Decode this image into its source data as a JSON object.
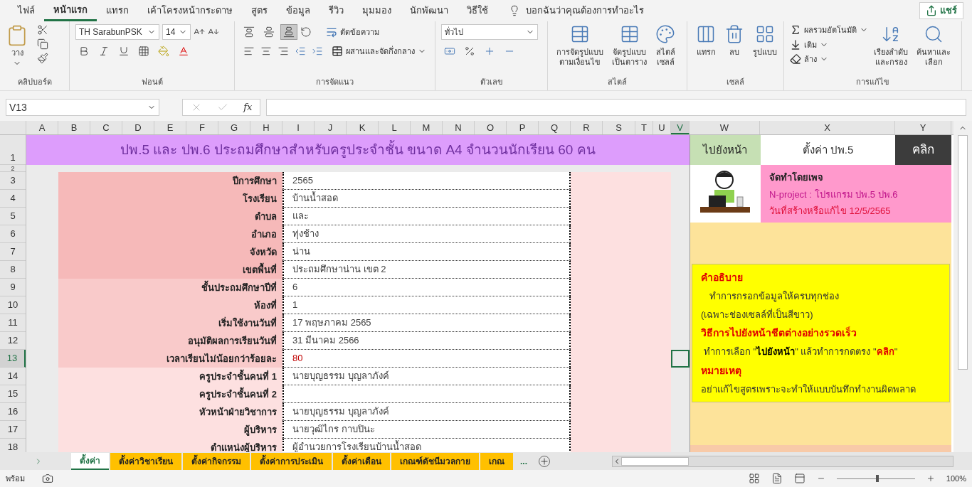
{
  "menu_tabs": [
    {
      "label": "ไฟล์",
      "selected": false
    },
    {
      "label": "หน้าแรก",
      "selected": true
    },
    {
      "label": "แทรก",
      "selected": false
    },
    {
      "label": "เค้าโครงหน้ากระดาษ",
      "selected": false
    },
    {
      "label": "สูตร",
      "selected": false
    },
    {
      "label": "ข้อมูล",
      "selected": false
    },
    {
      "label": "รีวิว",
      "selected": false
    },
    {
      "label": "มุมมอง",
      "selected": false
    },
    {
      "label": "นักพัฒนา",
      "selected": false
    },
    {
      "label": "วิธีใช้",
      "selected": false
    }
  ],
  "tell_me": "บอกฉันว่าคุณต้องการทำอะไร",
  "share": "แชร์",
  "ribbon": {
    "clipboard": {
      "title": "คลิปบอร์ด",
      "paste": "วาง"
    },
    "font": {
      "title": "ฟอนต์",
      "family": "TH SarabunPSK",
      "size": "14"
    },
    "alignment": {
      "title": "การจัดแนว",
      "vertical": [
        {
          "selected": false
        },
        {
          "selected": false
        },
        {
          "selected": true
        }
      ],
      "wrap": "ตัดข้อความ",
      "merge": "ผสานและจัดกึ่งกลาง"
    },
    "number": {
      "title": "ตัวเลข",
      "format": "ทั่วไป"
    },
    "styles": {
      "title": "สไตล์",
      "buttons": [
        {
          "lines": [
            "การจัดรูปแบบ",
            "ตามเงื่อนไข"
          ]
        },
        {
          "lines": [
            "จัดรูปแบบ",
            "เป็นตาราง"
          ]
        },
        {
          "lines": [
            "สไตล์",
            "เซลล์"
          ]
        }
      ]
    },
    "cells": {
      "title": "เซลล์",
      "buttons": [
        "แทรก",
        "ลบ",
        "รูปแบบ"
      ]
    },
    "editing": {
      "title": "การแก้ไข",
      "small": [
        "ผลรวมอัตโนมัติ",
        "เติม",
        "ล้าง"
      ],
      "big": [
        {
          "lines": [
            "เรียงลำดับ",
            "และกรอง"
          ]
        },
        {
          "lines": [
            "ค้นหาและ",
            "เลือก"
          ]
        }
      ]
    }
  },
  "name_box": "V13",
  "function_label": "fx",
  "columns": [
    {
      "label": "A",
      "selected": false
    },
    {
      "label": "B",
      "selected": false
    },
    {
      "label": "C",
      "selected": false
    },
    {
      "label": "D",
      "selected": false
    },
    {
      "label": "E",
      "selected": false
    },
    {
      "label": "F",
      "selected": false
    },
    {
      "label": "G",
      "selected": false
    },
    {
      "label": "H",
      "selected": false
    },
    {
      "label": "I",
      "selected": false
    },
    {
      "label": "J",
      "selected": false
    },
    {
      "label": "K",
      "selected": false
    },
    {
      "label": "L",
      "selected": false
    },
    {
      "label": "M",
      "selected": false
    },
    {
      "label": "N",
      "selected": false
    },
    {
      "label": "O",
      "selected": false
    },
    {
      "label": "P",
      "selected": false
    },
    {
      "label": "Q",
      "selected": false
    },
    {
      "label": "R",
      "selected": false
    },
    {
      "label": "S",
      "selected": false
    },
    {
      "label": "T",
      "selected": false
    },
    {
      "label": "U",
      "selected": false
    },
    {
      "label": "V",
      "selected": true
    },
    {
      "label": "W",
      "selected": false
    },
    {
      "label": "X",
      "selected": false
    },
    {
      "label": "Y",
      "selected": false
    }
  ],
  "title_row": {
    "number": "1",
    "title": "ปพ.5 และ ปพ.6 ประถมศึกษาสำหรับครูประจำชั้น ขนาด A4 จำนวนนักเรียน 60 คน",
    "goto": "ไปยังหน้า",
    "target": "ตั้งค่า ปพ.5",
    "click": "คลิก"
  },
  "row_2": "2",
  "rows": [
    {
      "number": "3",
      "label": "ปีการศึกษา",
      "value": "2565",
      "kind": "dark",
      "color": "#404040",
      "selected": false
    },
    {
      "number": "4",
      "label": "โรงเรียน",
      "value": "บ้านน้ำสอด",
      "kind": "dark",
      "color": "#404040",
      "selected": false
    },
    {
      "number": "5",
      "label": "ตำบล",
      "value": "และ",
      "kind": "dark",
      "color": "#404040",
      "selected": false
    },
    {
      "number": "6",
      "label": "อำเภอ",
      "value": "ทุ่งช้าง",
      "kind": "dark",
      "color": "#404040",
      "selected": false
    },
    {
      "number": "7",
      "label": "จังหวัด",
      "value": "น่าน",
      "kind": "dark",
      "color": "#404040",
      "selected": false
    },
    {
      "number": "8",
      "label": "เขตพื้นที่",
      "value": "ประถมศึกษาน่าน เขต 2",
      "kind": "dark",
      "color": "#404040",
      "selected": false
    },
    {
      "number": "9",
      "label": "ชั้นประถมศึกษาปีที่",
      "value": "6",
      "kind": "medium",
      "color": "#404040",
      "selected": false
    },
    {
      "number": "10",
      "label": "ห้องที่",
      "value": "1",
      "kind": "medium",
      "color": "#404040",
      "selected": false
    },
    {
      "number": "11",
      "label": "เริ่มใช้งานวันที่",
      "value": "17 พฤษภาคม 2565",
      "kind": "medium",
      "color": "#404040",
      "selected": false
    },
    {
      "number": "12",
      "label": "อนุมัติผลการเรียนวันที่",
      "value": "31 มีนาคม 2566",
      "kind": "medium",
      "color": "#404040",
      "selected": false
    },
    {
      "number": "13",
      "label": "เวลาเรียนไม่น้อยกว่าร้อยละ",
      "value": "80",
      "kind": "medium",
      "color": "#c00000",
      "selected": true
    },
    {
      "number": "14",
      "label": "ครูประจำชั้นคนที่ 1",
      "value": "นายบุญธรรม  บุญลาภังค์",
      "kind": "light",
      "color": "#404040",
      "selected": false
    },
    {
      "number": "15",
      "label": "ครูประจำชั้นคนที่ 2",
      "kind": "light",
      "color": "#404040",
      "selected": false
    },
    {
      "number": "16",
      "label": "หัวหน้าฝ่ายวิชาการ",
      "value": "นายบุญธรรม  บุญลาภังค์",
      "kind": "light",
      "color": "#404040",
      "selected": false
    },
    {
      "number": "17",
      "label": "ผู้บริหาร",
      "value": "นายวุฒิไกร  กาบปินะ",
      "kind": "light",
      "color": "#404040",
      "selected": false
    },
    {
      "number": "18",
      "label": "ตำแหน่งผู้บริหาร",
      "value": "ผู้อำนวยการโรงเรียนบ้านน้ำสอด",
      "kind": "light",
      "color": "#404040",
      "selected": false
    }
  ],
  "credit": {
    "author": "จัดทำโดยเพจ",
    "program": "N-project : โปรแกรม ปพ.5 ปพ.6",
    "date": "วันที่สร้างหรือแก้ไข 12/5/2565"
  },
  "notes": [
    {
      "kind": "heading",
      "text": "คำอธิบาย"
    },
    {
      "kind": "indent",
      "text": "ทำการกรอกข้อมูลให้ครบทุกช่อง"
    },
    {
      "kind": "text",
      "text": "(เฉพาะช่องเซลล์ที่เป็นสีขาว)"
    },
    {
      "kind": "heading",
      "text": "วิธีการไปยังหน้าชีตต่างอย่างรวดเร็ว"
    },
    {
      "kind": "mixed",
      "parts": [
        {
          "kind": "plain",
          "text": "ทำการเลือก \""
        },
        {
          "kind": "bold",
          "text": "ไปยังหน้า"
        },
        {
          "kind": "plain",
          "text": "\" แล้วทำการกดตรง \""
        },
        {
          "kind": "alert",
          "text": "คลิก"
        },
        {
          "kind": "plain",
          "text": "\""
        }
      ]
    },
    {
      "kind": "heading",
      "text": "หมายเหตุ"
    },
    {
      "kind": "text",
      "text": "อย่าแก้ไขสูตรเพราะจะทำให้แบบบันทึกทำงานผิดพลาด"
    }
  ],
  "sheet_tabs": [
    {
      "label": "ตั้งค่า",
      "selected": true
    },
    {
      "label": "ตั้งค่าวิชาเรียน",
      "selected": false
    },
    {
      "label": "ตั้งค่ากิจกรรม",
      "selected": false
    },
    {
      "label": "ตั้งค่าการประเมิน",
      "selected": false
    },
    {
      "label": "ตั้งค่าเดือน",
      "selected": false
    },
    {
      "label": "เกณฑ์ดัชนีมวลกาย",
      "selected": false
    },
    {
      "label": "เกณ",
      "selected": false
    }
  ],
  "more_tabs": "...",
  "status": {
    "ready": "พร้อม",
    "zoom": "100%",
    "level": 0.5
  }
}
